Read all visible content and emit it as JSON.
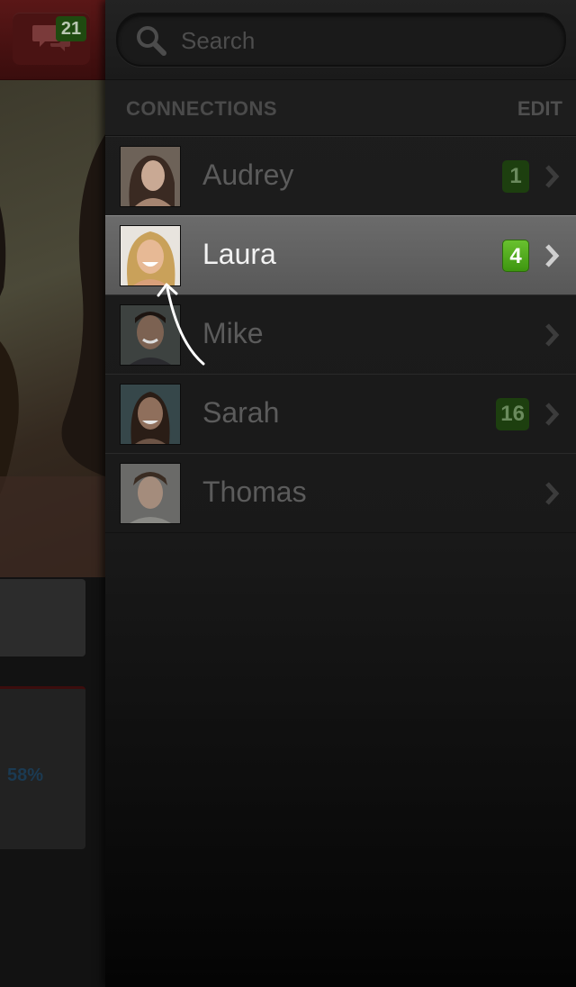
{
  "left_panel": {
    "chat_count": "21",
    "stat_percent": "58%"
  },
  "search": {
    "placeholder": "Search"
  },
  "connections": {
    "title": "CONNECTIONS",
    "edit_label": "EDIT",
    "items": [
      {
        "name": "Audrey",
        "badge": "1",
        "selected": false
      },
      {
        "name": "Laura",
        "badge": "4",
        "selected": true
      },
      {
        "name": "Mike",
        "badge": "",
        "selected": false
      },
      {
        "name": "Sarah",
        "badge": "16",
        "selected": false
      },
      {
        "name": "Thomas",
        "badge": "",
        "selected": false
      }
    ]
  },
  "colors": {
    "accent_green": "#4aa81a",
    "header_red": "#5a1717"
  }
}
